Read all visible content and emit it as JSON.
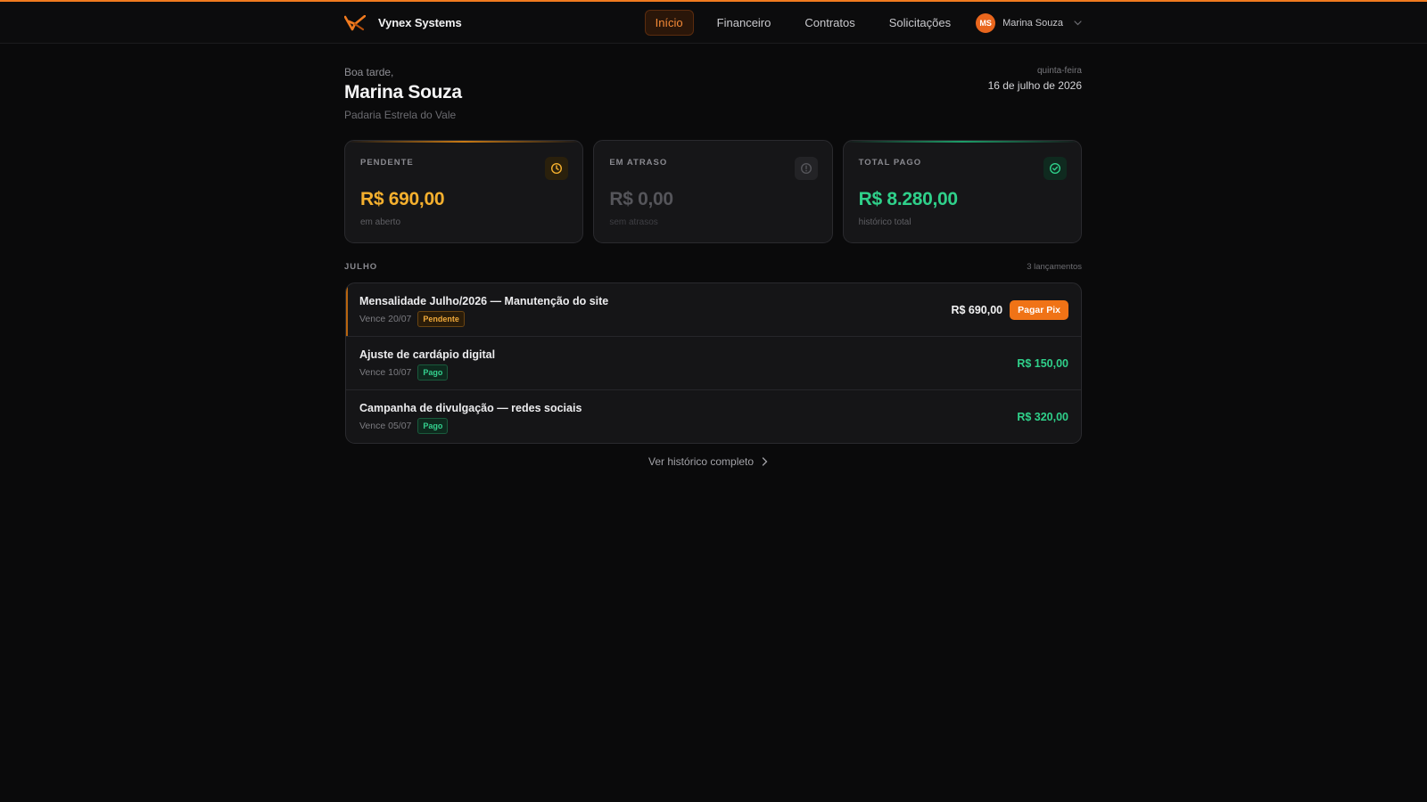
{
  "app": {
    "brand": "Vynex Systems"
  },
  "nav": {
    "items": [
      {
        "label": "Início",
        "active": true
      },
      {
        "label": "Financeiro",
        "active": false
      },
      {
        "label": "Contratos",
        "active": false
      },
      {
        "label": "Solicitações",
        "active": false
      }
    ],
    "user": {
      "initials": "MS",
      "name": "Marina Souza"
    }
  },
  "greeting": {
    "salutation": "Boa tarde,",
    "name": "Marina Souza",
    "company": "Padaria Estrela do Vale",
    "weekday": "quinta-feira",
    "date": "16 de julho de 2026"
  },
  "cards": [
    {
      "label": "PENDENTE",
      "value": "R$ 690,00",
      "sub": "em aberto",
      "color": "#f5b02e",
      "icon": "clock-icon"
    },
    {
      "label": "EM ATRASO",
      "value": "R$ 0,00",
      "sub": "sem atrasos",
      "color": "#55555a",
      "icon": "alert-circle-icon"
    },
    {
      "label": "TOTAL PAGO",
      "value": "R$ 8.280,00",
      "sub": "histórico total",
      "color": "#2fd08a",
      "icon": "check-circle-icon"
    }
  ],
  "month": {
    "label": "JULHO",
    "count": "3 lançamentos"
  },
  "invoices": [
    {
      "title": "Mensalidade Julho/2026 — Manutenção do site",
      "due": "Vence 20/07",
      "status": "Pendente",
      "amount": "R$ 690,00",
      "action": "Pagar Pix"
    },
    {
      "title": "Ajuste de cardápio digital",
      "due": "Vence 10/07",
      "status": "Pago",
      "amount": "R$ 150,00"
    },
    {
      "title": "Campanha de divulgação — redes sociais",
      "due": "Vence 05/07",
      "status": "Pago",
      "amount": "R$ 320,00"
    }
  ],
  "history_link": "Ver histórico completo",
  "colors": {
    "accent": "#f07a1f",
    "pending": "#f5b02e",
    "paid": "#2fd08a",
    "background": "#0a0a0b"
  }
}
